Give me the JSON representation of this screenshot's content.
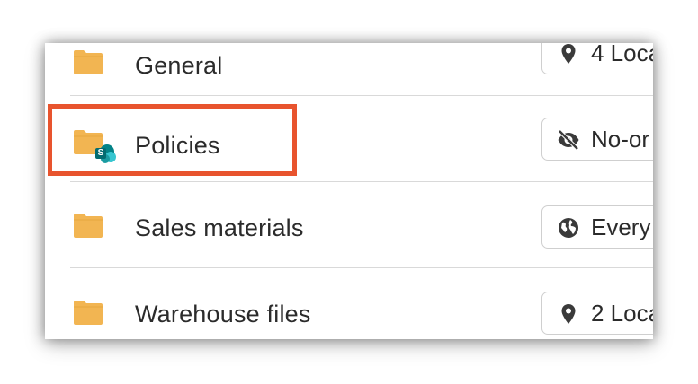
{
  "colors": {
    "folder": "#f2b552",
    "text": "#2b2b2b",
    "divider": "#d9d9d9",
    "highlight": "#e8542e",
    "sharepoint": "#038387"
  },
  "rows": [
    {
      "name": "General",
      "access_icon": "location-pin-icon",
      "access_label": "4 Loca"
    },
    {
      "name": "Policies",
      "access_icon": "eye-off-icon",
      "access_label": "No-or",
      "overlay_icon": "sharepoint-icon",
      "overlay_letter": "S",
      "highlighted": true
    },
    {
      "name": "Sales materials",
      "access_icon": "globe-icon",
      "access_label": "Every"
    },
    {
      "name": "Warehouse files",
      "access_icon": "location-pin-icon",
      "access_label": "2 Loca"
    }
  ]
}
